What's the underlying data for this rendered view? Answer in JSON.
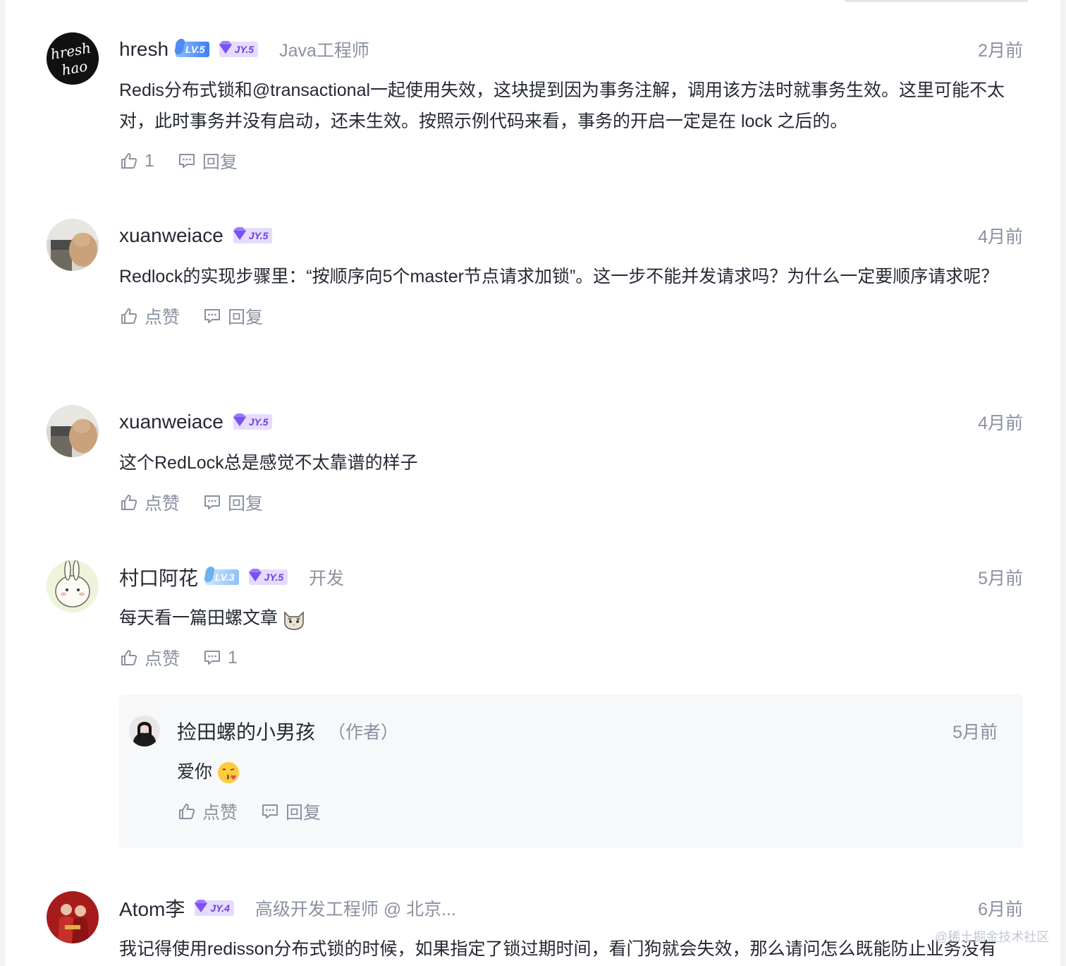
{
  "comments": [
    {
      "username": "hresh",
      "avatar_text": [
        "hresh",
        "hao"
      ],
      "level_badge": "LV.5",
      "jy_badge": "JY.5",
      "job_title": "Java工程师",
      "time": "2月前",
      "text": "Redis分布式锁和@transactional一起使用失效，这块提到因为事务注解，调用该方法时就事务生效。这里可能不太对，此时事务并没有启动，还未生效。按照示例代码来看，事务的开启一定是在 lock 之后的。",
      "like_label": "1",
      "reply_label": "回复"
    },
    {
      "username": "xuanweiace",
      "jy_badge": "JY.5",
      "time": "4月前",
      "text": "Redlock的实现步骤里：“按顺序向5个master节点请求加锁”。这一步不能并发请求吗？为什么一定要顺序请求呢？",
      "like_label": "点赞",
      "reply_label": "回复"
    },
    {
      "username": "xuanweiace",
      "jy_badge": "JY.5",
      "time": "4月前",
      "text": "这个RedLock总是感觉不太靠谱的样子",
      "like_label": "点赞",
      "reply_label": "回复"
    },
    {
      "username": "村口阿花",
      "level_badge": "LV.3",
      "jy_badge": "JY.5",
      "job_title": "开发",
      "time": "5月前",
      "text": "每天看一篇田螺文章",
      "like_label": "点赞",
      "reply_label": "1",
      "reply": {
        "username": "捡田螺的小男孩",
        "author_tag": "（作者）",
        "time": "5月前",
        "text": "爱你",
        "like_label": "点赞",
        "reply_label": "回复"
      }
    },
    {
      "username": "Atom李",
      "jy_badge": "JY.4",
      "job_title": "高级开发工程师 @ 北京...",
      "time": "6月前",
      "text": "我记得使用redisson分布式锁的时候，如果指定了锁过期时间，看门狗就会失效，那么请问怎么既能防止业务没有"
    }
  ],
  "watermark": "@稀土掘金技术社区",
  "colors": {
    "text": "#252933",
    "muted": "#8a919f",
    "lv": "#4e8cf0",
    "jy": "#6d3fd8",
    "jy_bg": "#e5dbff"
  }
}
